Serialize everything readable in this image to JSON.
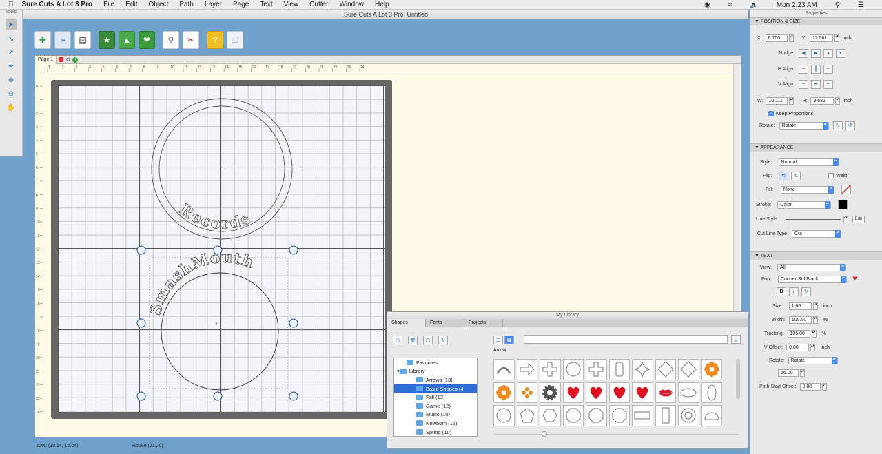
{
  "menubar": {
    "apple": "",
    "app": "Sure Cuts A Lot 3 Pro",
    "items": [
      "File",
      "Edit",
      "Object",
      "Path",
      "Layer",
      "Page",
      "Text",
      "View",
      "Cutter",
      "Window",
      "Help"
    ],
    "clock": "Mon 2:23 AM"
  },
  "tools_title": "Tools",
  "window_title": "Sure Cuts A Lot 3 Pro: Untitled",
  "page": {
    "tab": "Page 1"
  },
  "ruler": {
    "h_ticks": [
      "1",
      "2",
      "3",
      "4",
      "5",
      "6",
      "7",
      "8",
      "9",
      "10",
      "11",
      "12",
      "13",
      "14",
      "15",
      "16",
      "17",
      "18",
      "19",
      "20",
      "21",
      "22",
      "23",
      "24"
    ],
    "v_ticks": [
      "0",
      "1",
      "2",
      "3",
      "4",
      "5",
      "6",
      "7",
      "8",
      "9",
      "10",
      "11",
      "12",
      "13",
      "14",
      "15",
      "16",
      "17",
      "18",
      "19",
      "20",
      "21",
      "22",
      "23",
      "24"
    ]
  },
  "canvas_text": {
    "curved_top": "Records",
    "curved_bottom": "SmashMouth"
  },
  "status": {
    "zoom_info": "30%; (18.14, 15.64)",
    "mode": "Rotate (21.20)"
  },
  "properties": {
    "title": "Properties",
    "position_size": {
      "header": "POSITION & SIZE",
      "x_label": "X:",
      "x": "6.700",
      "y_label": "Y:",
      "y": "12.561",
      "unit": "inch",
      "nudge": "Nudge:",
      "h_align": "H Align:",
      "v_align": "V Align:",
      "w_label": "W:",
      "w": "10.111",
      "h_label": "H:",
      "h": "9.682",
      "keep": "Keep Proportions",
      "keep_checked": true,
      "rotate_label": "Rotate:",
      "rotate": "Rotate"
    },
    "appearance": {
      "header": "APPEARANCE",
      "style_label": "Style:",
      "style": "Normal",
      "flip_label": "Flip:",
      "weld": "Weld",
      "fill_label": "Fill:",
      "fill": "None",
      "stroke_label": "Stroke:",
      "stroke": "Color",
      "stroke_color": "#000000",
      "linestyle_label": "Line Style:",
      "edit": "Edit",
      "cutline_label": "Cut Line Type:",
      "cutline": "Cut"
    },
    "text": {
      "header": "TEXT",
      "view_label": "View:",
      "view": "All",
      "font_label": "Font:",
      "font": "Cooper Std Black",
      "size_label": "Size:",
      "size": "1.60",
      "size_unit": "inch",
      "width_label": "Width:",
      "width": "100.00",
      "pct": "%",
      "tracking_label": "Tracking:",
      "tracking": "105.00",
      "voffset_label": "V Offset:",
      "voffset": "0.00",
      "rotate_label": "Rotate:",
      "rotate": "Rotate",
      "rotate_val": "16.00",
      "pso_label": "Path Start Offset:",
      "pso": "0.88"
    }
  },
  "library": {
    "title": "My Library",
    "tabs": [
      "Shapes",
      "Fonts",
      "Projects"
    ],
    "category": "Arrow",
    "tree": [
      {
        "label": "Favorites",
        "indent": 1
      },
      {
        "label": "Library",
        "indent": 0
      },
      {
        "label": "Arrows (18)",
        "indent": 2
      },
      {
        "label": "Basic Shapes (4",
        "indent": 2,
        "selected": true
      },
      {
        "label": "Fall (12)",
        "indent": 2
      },
      {
        "label": "Game (12)",
        "indent": 2
      },
      {
        "label": "Music (10)",
        "indent": 2
      },
      {
        "label": "Newborn (15)",
        "indent": 2
      },
      {
        "label": "Spring (10)",
        "indent": 2
      }
    ],
    "shapes": [
      "arc-outline",
      "arrow-outline",
      "puzzle-cross-outline",
      "circle-outline",
      "cross-outline",
      "rounded-rect-outline",
      "star4-outline",
      "diamond-outline",
      "diamond-outline",
      "flower-orange",
      "flower-orange",
      "flower-orange-small",
      "gear-gray",
      "heart-red",
      "heart-red",
      "heart-red",
      "heart-red",
      "lips-red",
      "ellipse-outline",
      "ellipse-tall-outline",
      "circle-outline",
      "pentagon-outline",
      "hexagon-outline",
      "octagon-outline",
      "octagon-outline",
      "octagon-outline",
      "rect-wide-outline",
      "rect-tall-outline",
      "ring-outline",
      "dome-outline"
    ]
  }
}
